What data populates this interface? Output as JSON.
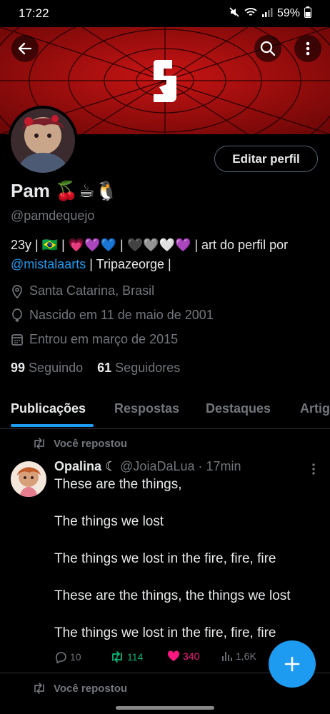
{
  "status_bar": {
    "time": "17:22",
    "battery": "59%"
  },
  "colors": {
    "accent": "#1d9bf0",
    "retweet": "#00ba7c",
    "like": "#f91880",
    "muted": "#71767b",
    "banner_red": "#b00e0e"
  },
  "header": {
    "back_icon": "arrow-left-icon",
    "search_icon": "search-icon",
    "more_icon": "more-vertical-icon"
  },
  "profile": {
    "edit_label": "Editar perfil",
    "name": "Pam 🍒☕🐧",
    "handle": "@pamdequejo",
    "bio_line1": "23y | 🇧🇷 | 💗💜💙 | 🖤🩶🤍💜 | art do perfil por",
    "bio_link": "@mistalaarts",
    "bio_line2_rest": " | Tripazeorge |",
    "location": "Santa Catarina, Brasil",
    "birth": "Nascido em 11 de maio de 2001",
    "joined": "Entrou em março de 2015",
    "following_count": "99",
    "following_label": "Seguindo",
    "followers_count": "61",
    "followers_label": "Seguidores"
  },
  "tabs": [
    "Publicações",
    "Respostas",
    "Destaques",
    "Artigos"
  ],
  "feed": {
    "repost_label": "Você repostou",
    "post": {
      "author_name": "Opalina ☾",
      "author_handle": "@JoiaDaLua",
      "time": "· 17min",
      "lines": [
        "These are the things,",
        "The things we lost",
        "The things we lost in the fire, fire, fire",
        "These are the things, the things we lost",
        "The things we lost in the fire, fire, fire"
      ],
      "replies": "10",
      "reposts": "114",
      "likes": "340",
      "views": "1,6K"
    },
    "second_repost_label": "Você repostou"
  }
}
